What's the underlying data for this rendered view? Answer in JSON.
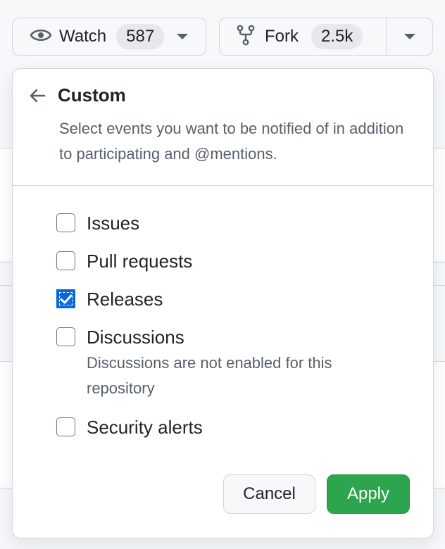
{
  "watch": {
    "label": "Watch",
    "count": "587",
    "icon": "eye-icon"
  },
  "fork": {
    "label": "Fork",
    "count": "2.5k",
    "icon": "repo-forked-icon"
  },
  "popup": {
    "title": "Custom",
    "description": "Select events you want to be notified of in addition to participating and @mentions.",
    "back_icon": "arrow-left-icon",
    "options": [
      {
        "label": "Issues",
        "checked": false,
        "note": ""
      },
      {
        "label": "Pull requests",
        "checked": false,
        "note": ""
      },
      {
        "label": "Releases",
        "checked": true,
        "note": ""
      },
      {
        "label": "Discussions",
        "checked": false,
        "note": "Discussions are not enabled for this repository"
      },
      {
        "label": "Security alerts",
        "checked": false,
        "note": ""
      }
    ],
    "cancel_label": "Cancel",
    "apply_label": "Apply"
  },
  "colors": {
    "accent": "#0969da",
    "apply": "#2da44e",
    "border": "#d0d7de",
    "muted_text": "#57606a"
  }
}
